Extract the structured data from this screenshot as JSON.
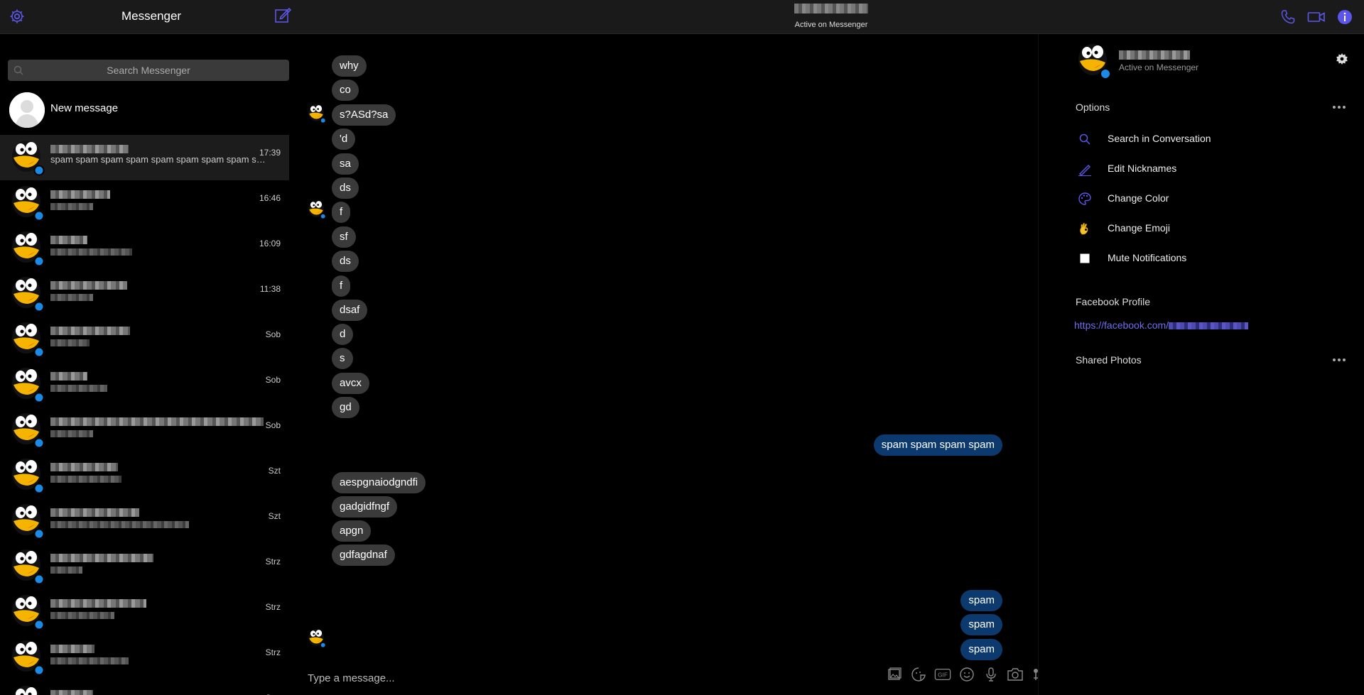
{
  "app": {
    "title": "Messenger"
  },
  "header": {
    "contact_status": "Active on Messenger",
    "accent": "#5c56e8"
  },
  "sidebar": {
    "search_placeholder": "Search Messenger",
    "new_message_label": "New message",
    "conversations": [
      {
        "time": "17:39",
        "preview": "spam spam spam spam spam spam spam spam spam spam",
        "active": true
      },
      {
        "time": "16:46"
      },
      {
        "time": "16:09"
      },
      {
        "time": "11:38"
      },
      {
        "time": "Sob"
      },
      {
        "time": "Sob"
      },
      {
        "time": "Sob"
      },
      {
        "time": "Szt"
      },
      {
        "time": "Szt"
      },
      {
        "time": "Strz"
      },
      {
        "time": "Strz"
      },
      {
        "time": "Strz"
      },
      {
        "time": "Strz"
      }
    ]
  },
  "chat": {
    "messages": [
      {
        "text": "why",
        "dir": "in"
      },
      {
        "text": "co",
        "dir": "in"
      },
      {
        "text": "s?ASd?sa",
        "dir": "in"
      },
      {
        "text": "'d",
        "dir": "in"
      },
      {
        "text": "sa",
        "dir": "in"
      },
      {
        "text": "ds",
        "dir": "in"
      },
      {
        "text": "f",
        "dir": "in"
      },
      {
        "text": "sf",
        "dir": "in"
      },
      {
        "text": "ds",
        "dir": "in"
      },
      {
        "text": "f",
        "dir": "in"
      },
      {
        "text": "dsaf",
        "dir": "in"
      },
      {
        "text": "d",
        "dir": "in"
      },
      {
        "text": "s",
        "dir": "in"
      },
      {
        "text": "avcx",
        "dir": "in"
      },
      {
        "text": "gd",
        "dir": "in"
      },
      {
        "text": "spam spam spam spam",
        "dir": "out"
      },
      {
        "text": "aespgnaiodgndfi",
        "dir": "in"
      },
      {
        "text": "gadgidfngf",
        "dir": "in"
      },
      {
        "text": "apgn",
        "dir": "in"
      },
      {
        "text": "gdfagdnaf",
        "dir": "in"
      },
      {
        "text": "spam",
        "dir": "out"
      },
      {
        "text": "spam",
        "dir": "out"
      },
      {
        "text": "spam",
        "dir": "out"
      }
    ],
    "composer_placeholder": "Type a message...",
    "composer_icons": [
      "image-icon",
      "sticker-icon",
      "gif-icon",
      "emoji-icon",
      "microphone-icon",
      "camera-icon",
      "game-icon"
    ]
  },
  "right_panel": {
    "status": "Active on Messenger",
    "options_heading": "Options",
    "options": [
      {
        "label": "Search in Conversation",
        "icon": "search-icon"
      },
      {
        "label": "Edit Nicknames",
        "icon": "pencil-icon"
      },
      {
        "label": "Change Color",
        "icon": "palette-icon"
      },
      {
        "label": "Change Emoji",
        "icon": "ok-hand-emoji-icon"
      },
      {
        "label": "Mute Notifications",
        "icon": "checkbox-icon"
      }
    ],
    "profile_heading": "Facebook Profile",
    "profile_link_prefix": "https://facebook.com/",
    "shared_photos_heading": "Shared Photos"
  }
}
